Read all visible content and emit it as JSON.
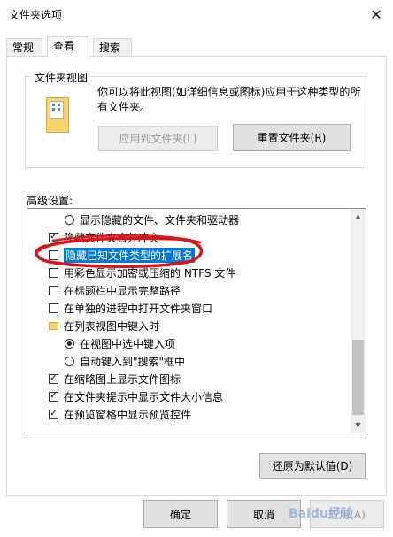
{
  "window": {
    "title": "文件夹选项",
    "close_glyph": "✕"
  },
  "tabs": [
    {
      "label": "常规",
      "active": false
    },
    {
      "label": "查看",
      "active": true
    },
    {
      "label": "搜索",
      "active": false
    }
  ],
  "folder_views": {
    "group_label": "文件夹视图",
    "description": "你可以将此视图(如详细信息或图标)应用于这种类型的所有文件夹。",
    "apply_button": "应用到文件夹(L)",
    "reset_button": "重置文件夹(R)"
  },
  "advanced": {
    "label": "高级设置:",
    "items": [
      {
        "type": "radio",
        "checked": false,
        "label": "显示隐藏的文件、文件夹和驱动器"
      },
      {
        "type": "checkbox",
        "checked": true,
        "label": "隐藏文件夹合并冲突"
      },
      {
        "type": "checkbox",
        "checked": false,
        "label": "隐藏已知文件类型的扩展名",
        "selected": true
      },
      {
        "type": "checkbox",
        "checked": false,
        "label": "用彩色显示加密或压缩的 NTFS 文件"
      },
      {
        "type": "checkbox",
        "checked": false,
        "label": "在标题栏中显示完整路径"
      },
      {
        "type": "checkbox",
        "checked": false,
        "label": "在单独的进程中打开文件夹窗口"
      },
      {
        "type": "folder",
        "label": "在列表视图中键入时"
      },
      {
        "type": "radio",
        "checked": true,
        "label": "在视图中选中键入项"
      },
      {
        "type": "radio",
        "checked": false,
        "label": "自动键入到\"搜索\"框中"
      },
      {
        "type": "checkbox",
        "checked": true,
        "label": "在缩略图上显示文件图标"
      },
      {
        "type": "checkbox",
        "checked": true,
        "label": "在文件夹提示中显示文件大小信息"
      },
      {
        "type": "checkbox",
        "checked": true,
        "label": "在预览窗格中显示预览控件"
      }
    ],
    "restore_button": "还原为默认值(D)"
  },
  "footer": {
    "ok": "确定",
    "cancel": "取消",
    "apply": "应用(A)"
  },
  "watermark": "Baidu经验",
  "colors": {
    "selection": "#0078d7",
    "annotation": "#d8141c",
    "primary_border": "#0078d7"
  }
}
